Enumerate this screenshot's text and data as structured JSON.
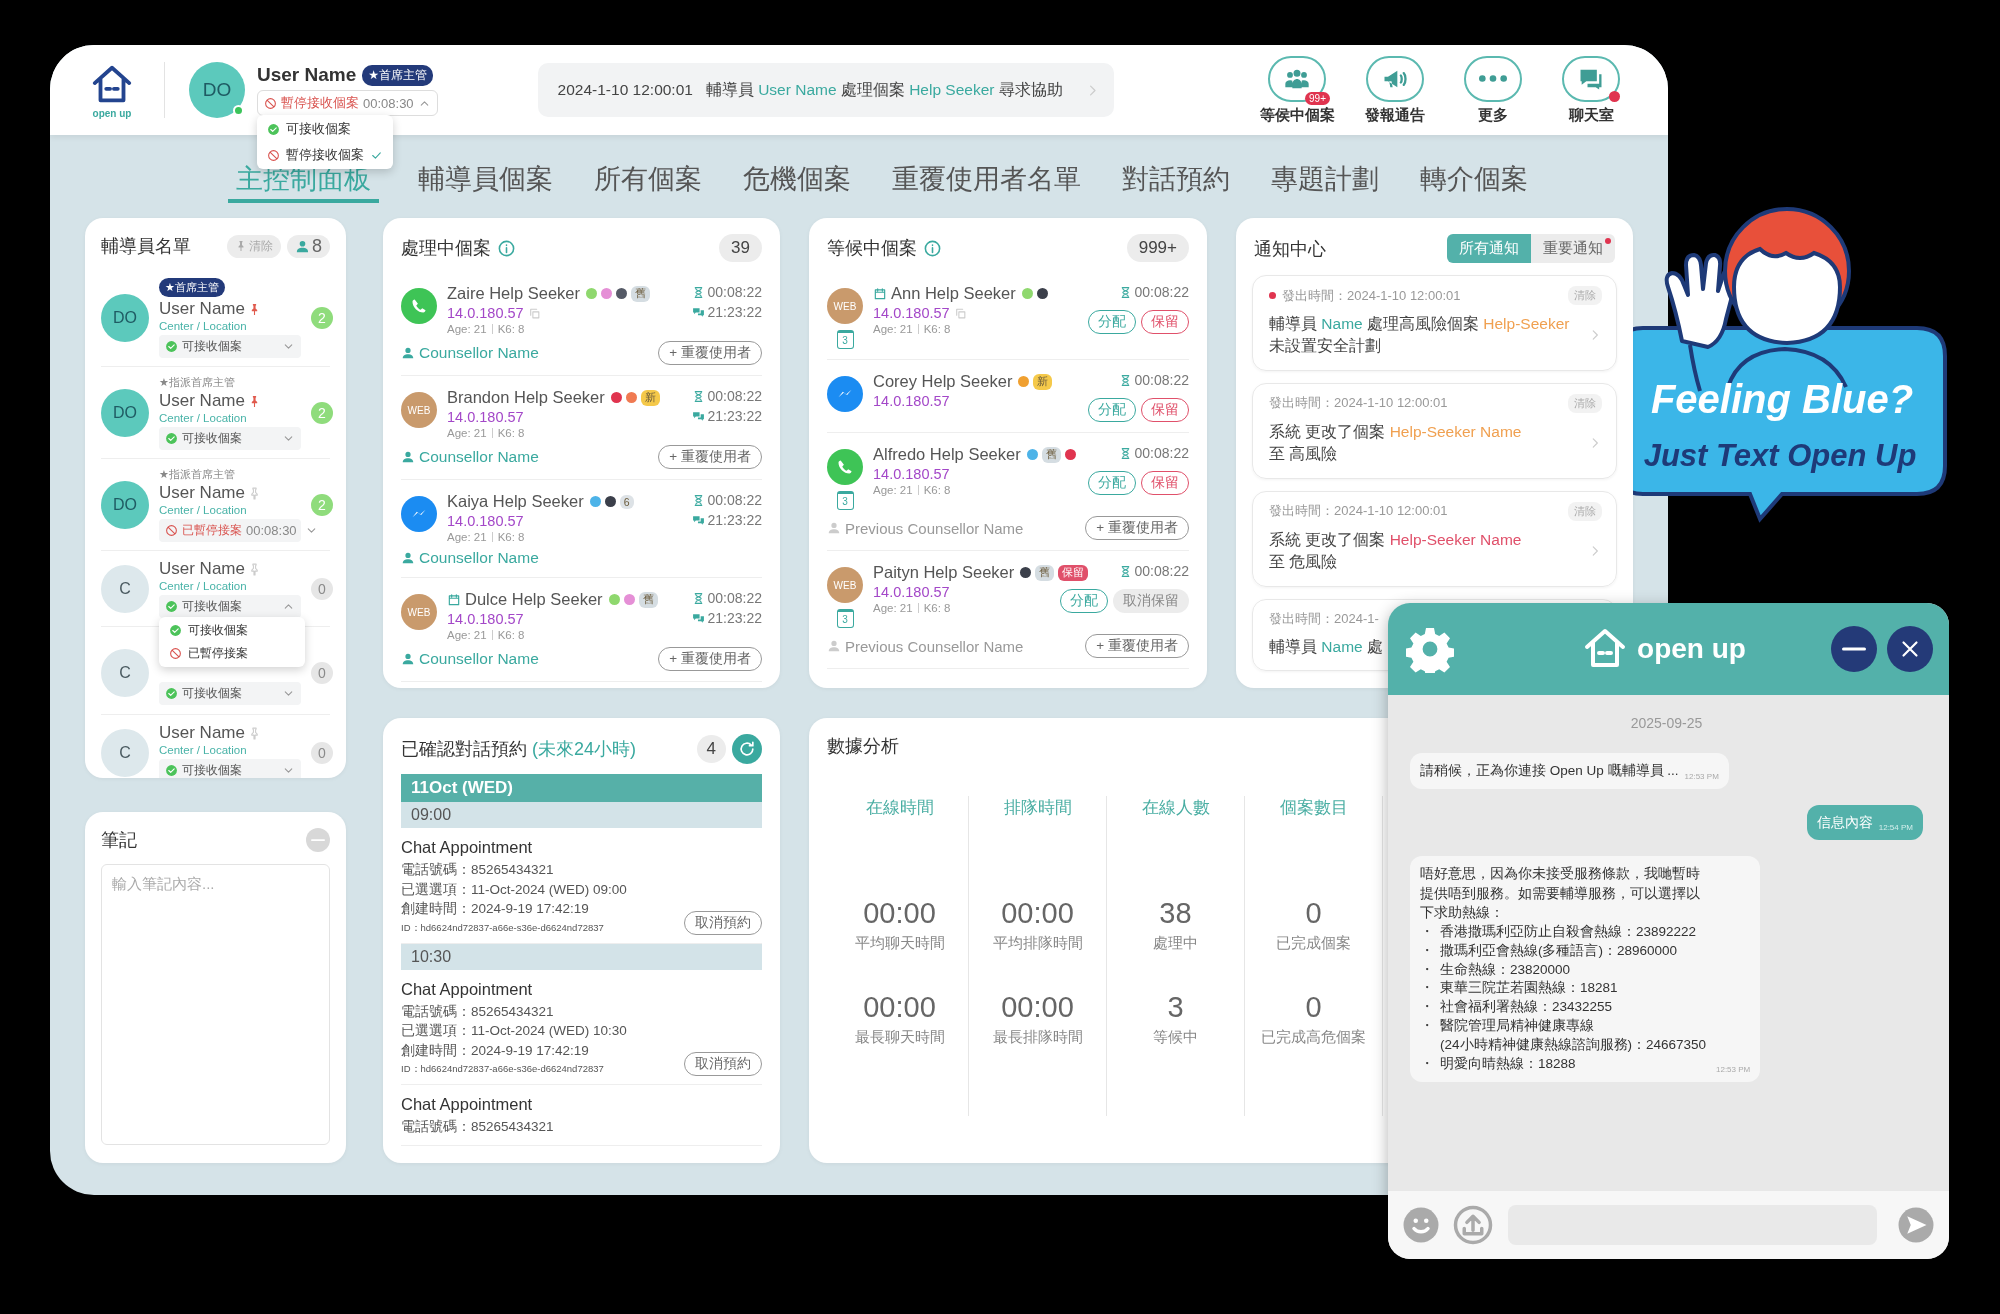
{
  "header": {
    "logo_caption": "open up",
    "user": {
      "initials": "DO",
      "online": true,
      "name": "User Name",
      "role": "★首席主管",
      "status": {
        "kind": "paused",
        "label": "暫停接收個案",
        "timer": "00:08:30"
      },
      "expanded": true
    },
    "status_menu": [
      {
        "label": "可接收個案",
        "kind": "available",
        "selected": false
      },
      {
        "label": "暫停接收個案",
        "kind": "paused",
        "selected": true
      }
    ],
    "ticker": {
      "time": "2024-1-10 12:00:01",
      "parts": [
        {
          "text": "輔導員 ",
          "accent": false
        },
        {
          "text": "User Name",
          "accent": true
        },
        {
          "text": " 處理個案 ",
          "accent": false
        },
        {
          "text": "Help Seeker",
          "accent": true
        },
        {
          "text": " 尋求協助",
          "accent": false
        }
      ]
    },
    "actions": [
      {
        "label": "等侯中個案",
        "kind": "queue",
        "badge": "99+",
        "alert": false
      },
      {
        "label": "發報通告",
        "kind": "announce",
        "alert": false
      },
      {
        "label": "更多",
        "kind": "more",
        "alert": false
      },
      {
        "label": "聊天室",
        "kind": "chat",
        "alert": true
      }
    ]
  },
  "tabs": [
    {
      "label": "主控制面板",
      "selected": true
    },
    {
      "label": "輔導員個案",
      "selected": false
    },
    {
      "label": "所有個案",
      "selected": false
    },
    {
      "label": "危機個案",
      "selected": false
    },
    {
      "label": "重覆使用者名單",
      "selected": false
    },
    {
      "label": "對話預約",
      "selected": false
    },
    {
      "label": "專題計劃",
      "selected": false
    },
    {
      "label": "轉介個案",
      "selected": false
    }
  ],
  "counsellors": {
    "title": "輔導員名單",
    "clear_label": "清除",
    "count": "8",
    "items": [
      {
        "initials": "DO",
        "active": true,
        "role": {
          "text": "★首席主管",
          "kind": "chief"
        },
        "name": "User Name",
        "location": "Center / Location",
        "pinned": true,
        "status": {
          "kind": "available",
          "label": "可接收個案"
        },
        "cases": "2",
        "expanded": false
      },
      {
        "initials": "DO",
        "active": true,
        "role": {
          "text": "★指派首席主管",
          "kind": "assigned"
        },
        "name": "User Name",
        "location": "Center / Location",
        "pinned": true,
        "status": {
          "kind": "available",
          "label": "可接收個案"
        },
        "cases": "2",
        "expanded": false
      },
      {
        "initials": "DO",
        "active": true,
        "role": {
          "text": "★指派首席主管",
          "kind": "assigned"
        },
        "name": "User Name",
        "location": "Center / Location",
        "pinned": false,
        "status": {
          "kind": "paused",
          "label": "已暫停接案",
          "timer": "00:08:30"
        },
        "cases": "2",
        "expanded": false
      },
      {
        "initials": "C",
        "active": false,
        "name": "User Name",
        "location": "Center / Location",
        "pinned": false,
        "status": {
          "kind": "available",
          "label": "可接收個案"
        },
        "cases": "0",
        "expanded": true,
        "menu": [
          {
            "label": "可接收個案",
            "kind": "available"
          },
          {
            "label": "已暫停接案",
            "kind": "paused"
          }
        ]
      },
      {
        "initials": "C",
        "active": false,
        "status": {
          "kind": "available",
          "label": "可接收個案"
        },
        "cases": "0",
        "expanded": false
      },
      {
        "initials": "C",
        "active": false,
        "name": "User Name",
        "location": "Center / Location",
        "pinned": false,
        "status": {
          "kind": "available",
          "label": "可接收個案"
        },
        "cases": "0",
        "expanded": false
      }
    ]
  },
  "notes": {
    "title": "筆記",
    "placeholder": "輸入筆記內容..."
  },
  "processing": {
    "title": "處理中個案",
    "count": "39",
    "items": [
      {
        "channel": {
          "kind": "whatsapp"
        },
        "scheduled": false,
        "name": "Zaire Help Seeker",
        "tags": [
          {
            "color": "#8fd86e"
          },
          {
            "color": "#e58fd6"
          },
          {
            "color": "#555a66"
          },
          {
            "text": "舊",
            "color": "#d5dde2"
          }
        ],
        "ip": "14.0.180.57",
        "copyable": true,
        "age": "Age: 21",
        "k6": "K6: 8",
        "wait": "00:08:22",
        "chat": "21:23:22",
        "counsellor": "Counsellor Name",
        "repeat_label": "+ 重覆使用者"
      },
      {
        "channel": {
          "kind": "web",
          "label": "WEB"
        },
        "scheduled": false,
        "name": "Brandon Help Seeker",
        "tags": [
          {
            "color": "#e0344f"
          },
          {
            "color": "#f07a52"
          },
          {
            "text": "新",
            "color": "#f5c94a"
          }
        ],
        "ip": "14.0.180.57",
        "copyable": false,
        "age": "Age: 21",
        "k6": "K6: 8",
        "wait": "00:08:22",
        "chat": "21:23:22",
        "counsellor": "Counsellor Name",
        "repeat_label": "+ 重覆使用者"
      },
      {
        "channel": {
          "kind": "messenger"
        },
        "scheduled": false,
        "name": "Kaiya Help Seeker",
        "tags": [
          {
            "color": "#4db3e8"
          },
          {
            "color": "#3b3f4a"
          },
          {
            "text": "6",
            "color": "#dde2e6"
          }
        ],
        "ip": "14.0.180.57",
        "copyable": false,
        "age": "Age: 21",
        "k6": "K6: 8",
        "wait": "00:08:22",
        "chat": "21:23:22",
        "counsellor": "Counsellor Name"
      },
      {
        "channel": {
          "kind": "web",
          "label": "WEB"
        },
        "scheduled": true,
        "name": "Dulce Help Seeker",
        "tags": [
          {
            "color": "#8fd86e"
          },
          {
            "color": "#e58fd6"
          },
          {
            "text": "舊",
            "color": "#d5dde2"
          }
        ],
        "ip": "14.0.180.57",
        "copyable": false,
        "age": "Age: 21",
        "k6": "K6: 8",
        "wait": "00:08:22",
        "chat": "21:23:22",
        "counsellor": "Counsellor Name",
        "repeat_label": "+ 重覆使用者"
      }
    ]
  },
  "waiting": {
    "title": "等候中個案",
    "count": "999+",
    "items": [
      {
        "channel": {
          "kind": "web",
          "label": "WEB"
        },
        "scheduled": true,
        "name": "Ann Help Seeker",
        "tags": [
          {
            "color": "#8fd86e"
          },
          {
            "color": "#3b3f4a"
          }
        ],
        "ip": "14.0.180.57",
        "copyable": true,
        "age": "Age: 21",
        "k6": "K6: 8",
        "queue_no": "3",
        "wait": "00:08:22",
        "actions": [
          {
            "label": "分配",
            "kind": "assign"
          },
          {
            "label": "保留",
            "kind": "hold"
          }
        ]
      },
      {
        "channel": {
          "kind": "messenger"
        },
        "scheduled": false,
        "name": "Corey Help Seeker",
        "tags": [
          {
            "color": "#f0a030"
          },
          {
            "text": "新",
            "color": "#f5c94a"
          }
        ],
        "ip": "14.0.180.57",
        "copyable": false,
        "wait": "00:08:22",
        "actions": [
          {
            "label": "分配",
            "kind": "assign"
          },
          {
            "label": "保留",
            "kind": "hold"
          }
        ]
      },
      {
        "channel": {
          "kind": "whatsapp"
        },
        "scheduled": false,
        "name": "Alfredo Help Seeker",
        "tags": [
          {
            "color": "#4db3e8"
          },
          {
            "text": "舊",
            "color": "#d5dde2"
          },
          {
            "color": "#e0344f"
          }
        ],
        "ip": "14.0.180.57",
        "copyable": false,
        "age": "Age: 21",
        "k6": "K6: 8",
        "queue_no": "3",
        "wait": "00:08:22",
        "actions": [
          {
            "label": "分配",
            "kind": "assign"
          },
          {
            "label": "保留",
            "kind": "hold"
          }
        ],
        "previous_counsellor": "Previous Counsellor Name",
        "repeat_label": "+ 重覆使用者"
      },
      {
        "channel": {
          "kind": "web",
          "label": "WEB"
        },
        "scheduled": false,
        "name": "Paityn Help Seeker",
        "tags": [
          {
            "color": "#3b3f4a"
          },
          {
            "text": "舊",
            "color": "#d5dde2"
          },
          {
            "text": "保留",
            "color": "#e0506a"
          }
        ],
        "ip": "14.0.180.57",
        "copyable": false,
        "age": "Age: 21",
        "k6": "K6: 8",
        "queue_no": "3",
        "wait": "00:08:22",
        "actions": [
          {
            "label": "分配",
            "kind": "assign"
          },
          {
            "label": "取消保留",
            "kind": "release"
          }
        ],
        "previous_counsellor": "Previous Counsellor Name",
        "repeat_label": "+ 重覆使用者"
      }
    ]
  },
  "notifications": {
    "title": "通知中心",
    "filters": [
      {
        "label": "所有通知",
        "selected": true,
        "alert": false
      },
      {
        "label": "重要通知",
        "selected": false,
        "alert": true
      }
    ],
    "items": [
      {
        "unread": true,
        "time": "發出時間：2024-1-10 12:00:01",
        "clear_label": "清除",
        "lines": [
          [
            {
              "text": "輔導員 ",
              "color": "#444444"
            },
            {
              "text": "Name",
              "color": "#3aa99f"
            },
            {
              "text": " 處理高風險個案 ",
              "color": "#444444"
            },
            {
              "text": "Help-Seeker",
              "color": "#f0a050"
            }
          ],
          [
            {
              "text": "未設置安全計劃",
              "color": "#444444"
            }
          ]
        ]
      },
      {
        "unread": false,
        "time": "發出時間：2024-1-10 12:00:01",
        "clear_label": "清除",
        "lines": [
          [
            {
              "text": "系統 更改了個案 ",
              "color": "#444444"
            },
            {
              "text": "Help-Seeker Name",
              "color": "#f0a050"
            }
          ],
          [
            {
              "text": "至 高風險",
              "color": "#444444"
            }
          ]
        ]
      },
      {
        "unread": false,
        "time": "發出時間：2024-1-10 12:00:01",
        "clear_label": "清除",
        "lines": [
          [
            {
              "text": "系統 更改了個案 ",
              "color": "#444444"
            },
            {
              "text": "Help-Seeker Name",
              "color": "#e0506a"
            }
          ],
          [
            {
              "text": "至 危風險",
              "color": "#444444"
            }
          ]
        ]
      },
      {
        "unread": false,
        "time": "發出時間：2024-1-",
        "lines": [
          [
            {
              "text": "輔導員 ",
              "color": "#444444"
            },
            {
              "text": "Name",
              "color": "#3aa99f"
            },
            {
              "text": " 處",
              "color": "#444444"
            }
          ]
        ]
      }
    ]
  },
  "appointments": {
    "title": "已確認對話預約",
    "subtitle": "(未來24小時)",
    "count": "4",
    "date": "11Oct (WED)",
    "slots": [
      {
        "time": "09:00",
        "items": [
          {
            "title": "Chat Appointment",
            "lines": [
              "電話號碼：85265434321",
              "已選選項：11-Oct-2024 (WED) 09:00",
              "創建時間：2024-9-19 17:42:19"
            ],
            "id": "ID：hd6624nd72837-a66e-s36e-d6624nd72837",
            "cancel_label": "取消預約"
          }
        ]
      },
      {
        "time": "10:30",
        "items": [
          {
            "title": "Chat Appointment",
            "lines": [
              "電話號碼：85265434321",
              "已選選項：11-Oct-2024 (WED) 10:30",
              "創建時間：2024-9-19 17:42:19"
            ],
            "id": "ID：hd6624nd72837-a66e-s36e-d6624nd72837",
            "cancel_label": "取消預約"
          },
          {
            "title": "Chat Appointment",
            "lines": [
              "電話號碼：85265434321"
            ]
          }
        ]
      }
    ]
  },
  "stats": {
    "title": "數據分析",
    "columns": [
      {
        "heading": "在線時間",
        "cells": [
          {
            "value": "00:00",
            "label": "平均聊天時間"
          },
          {
            "value": "00:00",
            "label": "最長聊天時間"
          }
        ]
      },
      {
        "heading": "排隊時間",
        "cells": [
          {
            "value": "00:00",
            "label": "平均排隊時間"
          },
          {
            "value": "00:00",
            "label": "最長排隊時間"
          }
        ]
      },
      {
        "heading": "在線人數",
        "cells": [
          {
            "value": "38",
            "label": "處理中"
          },
          {
            "value": "3",
            "label": "等候中"
          }
        ]
      },
      {
        "heading": "個案數目",
        "cells": [
          {
            "value": "0",
            "label": "已完成個案"
          },
          {
            "value": "0",
            "label": "已完成高危個案"
          }
        ]
      }
    ]
  },
  "chat": {
    "logo_caption": "open up",
    "date": "2025-09-25",
    "messages": [
      {
        "kind": "bot",
        "text": "請稍候，正為你連接 Open Up 嘅輔導員 ...",
        "time": "12:53 PM"
      },
      {
        "kind": "user",
        "text": "信息內容",
        "time": "12:54 PM"
      },
      {
        "kind": "bot",
        "text": "唔好意思，因為你未接受服務條款，我哋暫時提供唔到服務。如需要輔導服務，可以選擇以下求助熱線：",
        "items": [
          {
            "mark": "・",
            "text": "香港撒瑪利亞防止自殺會熱線：23892222"
          },
          {
            "mark": "・",
            "text": "撒瑪利亞會熱線(多種語言)：28960000"
          },
          {
            "mark": "・",
            "text": "生命熱線：23820000"
          },
          {
            "mark": "・",
            "text": "東華三院芷若園熱線：18281"
          },
          {
            "mark": "・",
            "text": "社會福利署熱線：23432255"
          },
          {
            "mark": "・",
            "text": "醫院管理局精神健康專線\n(24小時精神健康熱線諮詢服務)：24667350"
          },
          {
            "mark": "・",
            "text": "明愛向晴熱線：18288"
          }
        ],
        "time": "12:53 PM"
      }
    ]
  },
  "sticker": {
    "headline": "Feeling Blue?",
    "tagline": "Just Text Open Up"
  }
}
